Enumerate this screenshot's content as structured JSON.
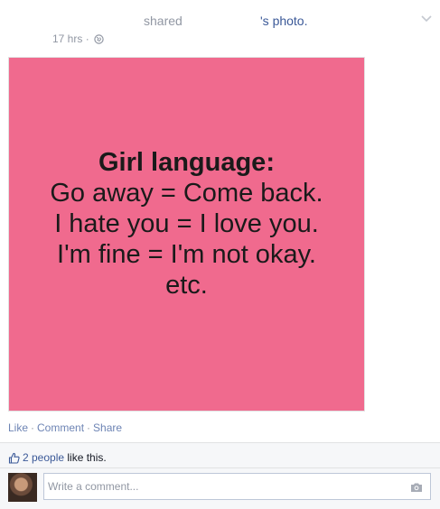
{
  "post": {
    "shared_text": "shared",
    "owner_possessive": "'s ",
    "photo_link": "photo",
    "period": ".",
    "time": "17 hrs",
    "meta_separator": " · ",
    "privacy_icon": "globe-icon",
    "menu_icon": "chevron-down-icon"
  },
  "image": {
    "background": "#f06a8e",
    "headline": "Girl language:",
    "lines": [
      "Go away = Come back.",
      "I hate you = I love you.",
      "I'm fine = I'm not okay.",
      "etc."
    ]
  },
  "actions": {
    "like": "Like",
    "comment": "Comment",
    "share": "Share",
    "separator": "·"
  },
  "likes": {
    "icon": "thumbs-up-icon",
    "people": "2 people",
    "rest": " like this."
  },
  "comment": {
    "placeholder": "Write a comment...",
    "camera_icon": "camera-icon"
  },
  "colors": {
    "link": "#3b5998",
    "muted": "#9197a3",
    "footer_bg": "#f6f7f9"
  }
}
